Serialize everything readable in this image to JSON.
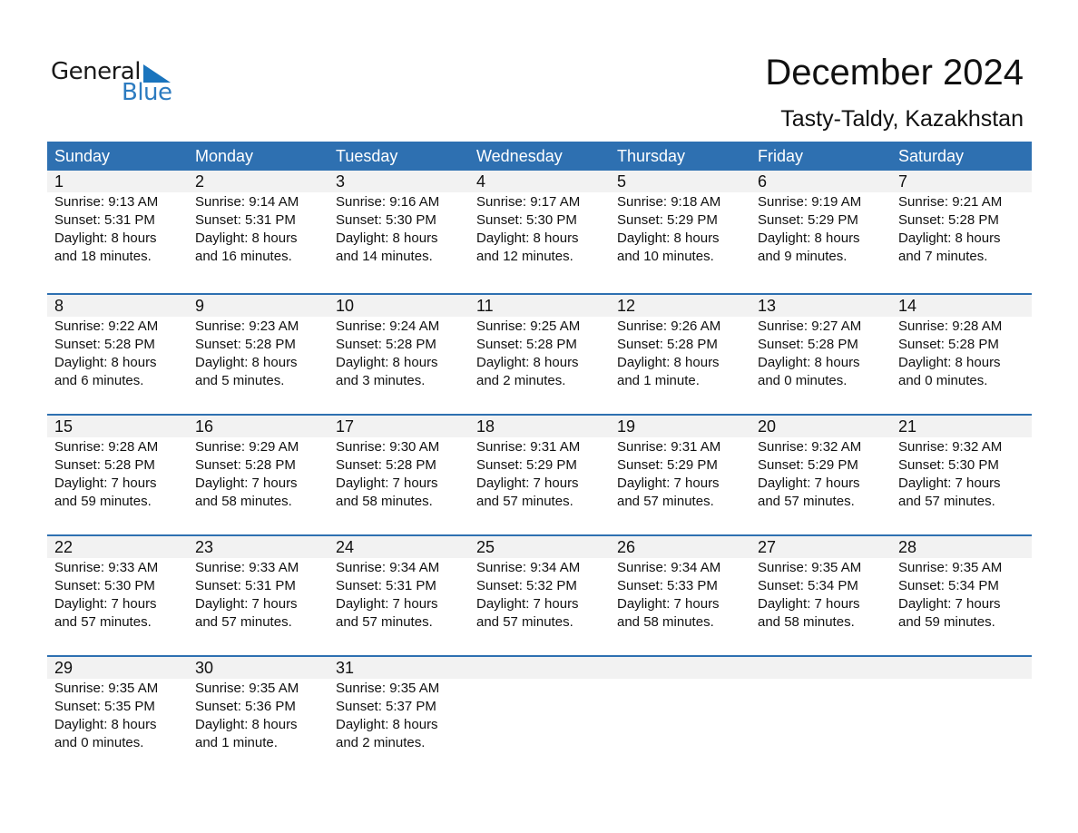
{
  "logo": {
    "line1": "General",
    "line2": "Blue",
    "brand_color": "#2c7bc0"
  },
  "header": {
    "title": "December 2024",
    "location": "Tasty-Taldy, Kazakhstan"
  },
  "colors": {
    "header_bg": "#2e70b1",
    "daynum_bg": "#f2f2f2"
  },
  "weekdays": [
    "Sunday",
    "Monday",
    "Tuesday",
    "Wednesday",
    "Thursday",
    "Friday",
    "Saturday"
  ],
  "weeks": [
    [
      {
        "day": "1",
        "sunrise": "Sunrise: 9:13 AM",
        "sunset": "Sunset: 5:31 PM",
        "daylight1": "Daylight: 8 hours",
        "daylight2": "and 18 minutes."
      },
      {
        "day": "2",
        "sunrise": "Sunrise: 9:14 AM",
        "sunset": "Sunset: 5:31 PM",
        "daylight1": "Daylight: 8 hours",
        "daylight2": "and 16 minutes."
      },
      {
        "day": "3",
        "sunrise": "Sunrise: 9:16 AM",
        "sunset": "Sunset: 5:30 PM",
        "daylight1": "Daylight: 8 hours",
        "daylight2": "and 14 minutes."
      },
      {
        "day": "4",
        "sunrise": "Sunrise: 9:17 AM",
        "sunset": "Sunset: 5:30 PM",
        "daylight1": "Daylight: 8 hours",
        "daylight2": "and 12 minutes."
      },
      {
        "day": "5",
        "sunrise": "Sunrise: 9:18 AM",
        "sunset": "Sunset: 5:29 PM",
        "daylight1": "Daylight: 8 hours",
        "daylight2": "and 10 minutes."
      },
      {
        "day": "6",
        "sunrise": "Sunrise: 9:19 AM",
        "sunset": "Sunset: 5:29 PM",
        "daylight1": "Daylight: 8 hours",
        "daylight2": "and 9 minutes."
      },
      {
        "day": "7",
        "sunrise": "Sunrise: 9:21 AM",
        "sunset": "Sunset: 5:28 PM",
        "daylight1": "Daylight: 8 hours",
        "daylight2": "and 7 minutes."
      }
    ],
    [
      {
        "day": "8",
        "sunrise": "Sunrise: 9:22 AM",
        "sunset": "Sunset: 5:28 PM",
        "daylight1": "Daylight: 8 hours",
        "daylight2": "and 6 minutes."
      },
      {
        "day": "9",
        "sunrise": "Sunrise: 9:23 AM",
        "sunset": "Sunset: 5:28 PM",
        "daylight1": "Daylight: 8 hours",
        "daylight2": "and 5 minutes."
      },
      {
        "day": "10",
        "sunrise": "Sunrise: 9:24 AM",
        "sunset": "Sunset: 5:28 PM",
        "daylight1": "Daylight: 8 hours",
        "daylight2": "and 3 minutes."
      },
      {
        "day": "11",
        "sunrise": "Sunrise: 9:25 AM",
        "sunset": "Sunset: 5:28 PM",
        "daylight1": "Daylight: 8 hours",
        "daylight2": "and 2 minutes."
      },
      {
        "day": "12",
        "sunrise": "Sunrise: 9:26 AM",
        "sunset": "Sunset: 5:28 PM",
        "daylight1": "Daylight: 8 hours",
        "daylight2": "and 1 minute."
      },
      {
        "day": "13",
        "sunrise": "Sunrise: 9:27 AM",
        "sunset": "Sunset: 5:28 PM",
        "daylight1": "Daylight: 8 hours",
        "daylight2": "and 0 minutes."
      },
      {
        "day": "14",
        "sunrise": "Sunrise: 9:28 AM",
        "sunset": "Sunset: 5:28 PM",
        "daylight1": "Daylight: 8 hours",
        "daylight2": "and 0 minutes."
      }
    ],
    [
      {
        "day": "15",
        "sunrise": "Sunrise: 9:28 AM",
        "sunset": "Sunset: 5:28 PM",
        "daylight1": "Daylight: 7 hours",
        "daylight2": "and 59 minutes."
      },
      {
        "day": "16",
        "sunrise": "Sunrise: 9:29 AM",
        "sunset": "Sunset: 5:28 PM",
        "daylight1": "Daylight: 7 hours",
        "daylight2": "and 58 minutes."
      },
      {
        "day": "17",
        "sunrise": "Sunrise: 9:30 AM",
        "sunset": "Sunset: 5:28 PM",
        "daylight1": "Daylight: 7 hours",
        "daylight2": "and 58 minutes."
      },
      {
        "day": "18",
        "sunrise": "Sunrise: 9:31 AM",
        "sunset": "Sunset: 5:29 PM",
        "daylight1": "Daylight: 7 hours",
        "daylight2": "and 57 minutes."
      },
      {
        "day": "19",
        "sunrise": "Sunrise: 9:31 AM",
        "sunset": "Sunset: 5:29 PM",
        "daylight1": "Daylight: 7 hours",
        "daylight2": "and 57 minutes."
      },
      {
        "day": "20",
        "sunrise": "Sunrise: 9:32 AM",
        "sunset": "Sunset: 5:29 PM",
        "daylight1": "Daylight: 7 hours",
        "daylight2": "and 57 minutes."
      },
      {
        "day": "21",
        "sunrise": "Sunrise: 9:32 AM",
        "sunset": "Sunset: 5:30 PM",
        "daylight1": "Daylight: 7 hours",
        "daylight2": "and 57 minutes."
      }
    ],
    [
      {
        "day": "22",
        "sunrise": "Sunrise: 9:33 AM",
        "sunset": "Sunset: 5:30 PM",
        "daylight1": "Daylight: 7 hours",
        "daylight2": "and 57 minutes."
      },
      {
        "day": "23",
        "sunrise": "Sunrise: 9:33 AM",
        "sunset": "Sunset: 5:31 PM",
        "daylight1": "Daylight: 7 hours",
        "daylight2": "and 57 minutes."
      },
      {
        "day": "24",
        "sunrise": "Sunrise: 9:34 AM",
        "sunset": "Sunset: 5:31 PM",
        "daylight1": "Daylight: 7 hours",
        "daylight2": "and 57 minutes."
      },
      {
        "day": "25",
        "sunrise": "Sunrise: 9:34 AM",
        "sunset": "Sunset: 5:32 PM",
        "daylight1": "Daylight: 7 hours",
        "daylight2": "and 57 minutes."
      },
      {
        "day": "26",
        "sunrise": "Sunrise: 9:34 AM",
        "sunset": "Sunset: 5:33 PM",
        "daylight1": "Daylight: 7 hours",
        "daylight2": "and 58 minutes."
      },
      {
        "day": "27",
        "sunrise": "Sunrise: 9:35 AM",
        "sunset": "Sunset: 5:34 PM",
        "daylight1": "Daylight: 7 hours",
        "daylight2": "and 58 minutes."
      },
      {
        "day": "28",
        "sunrise": "Sunrise: 9:35 AM",
        "sunset": "Sunset: 5:34 PM",
        "daylight1": "Daylight: 7 hours",
        "daylight2": "and 59 minutes."
      }
    ],
    [
      {
        "day": "29",
        "sunrise": "Sunrise: 9:35 AM",
        "sunset": "Sunset: 5:35 PM",
        "daylight1": "Daylight: 8 hours",
        "daylight2": "and 0 minutes."
      },
      {
        "day": "30",
        "sunrise": "Sunrise: 9:35 AM",
        "sunset": "Sunset: 5:36 PM",
        "daylight1": "Daylight: 8 hours",
        "daylight2": "and 1 minute."
      },
      {
        "day": "31",
        "sunrise": "Sunrise: 9:35 AM",
        "sunset": "Sunset: 5:37 PM",
        "daylight1": "Daylight: 8 hours",
        "daylight2": "and 2 minutes."
      },
      {
        "day": "",
        "sunrise": "",
        "sunset": "",
        "daylight1": "",
        "daylight2": ""
      },
      {
        "day": "",
        "sunrise": "",
        "sunset": "",
        "daylight1": "",
        "daylight2": ""
      },
      {
        "day": "",
        "sunrise": "",
        "sunset": "",
        "daylight1": "",
        "daylight2": ""
      },
      {
        "day": "",
        "sunrise": "",
        "sunset": "",
        "daylight1": "",
        "daylight2": ""
      }
    ]
  ]
}
